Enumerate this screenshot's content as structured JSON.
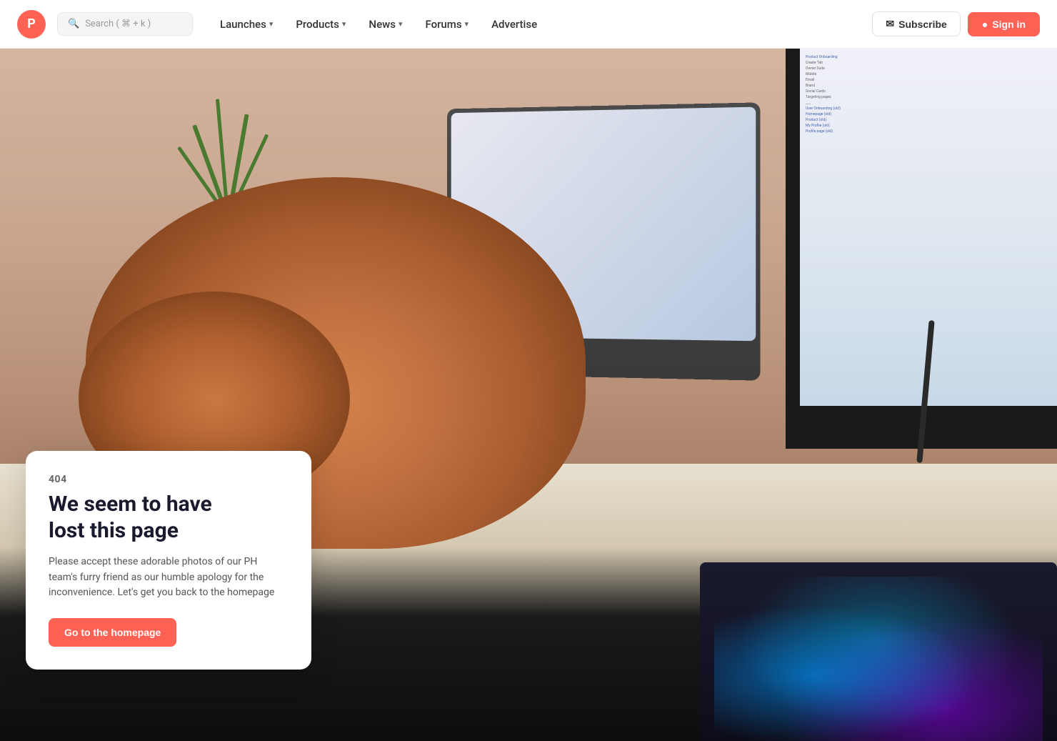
{
  "navbar": {
    "logo_letter": "P",
    "logo_bg": "#ff6154",
    "search_placeholder": "Search ( ⌘ + k )",
    "nav_items": [
      {
        "id": "launches",
        "label": "Launches",
        "has_chevron": true
      },
      {
        "id": "products",
        "label": "Products",
        "has_chevron": true
      },
      {
        "id": "news",
        "label": "News",
        "has_chevron": true
      },
      {
        "id": "forums",
        "label": "Forums",
        "has_chevron": true
      },
      {
        "id": "advertise",
        "label": "Advertise",
        "has_chevron": false
      }
    ],
    "subscribe_label": "Subscribe",
    "signin_label": "Sign in"
  },
  "error_page": {
    "code": "404",
    "title_line1": "We seem to have",
    "title_line2": "lost this page",
    "description": "Please accept these adorable photos of our PH team's furry friend as our humble apology for the inconvenience. Let's get you back to the homepage",
    "cta_label": "Go to the homepage"
  },
  "monitor_content": {
    "items": [
      "Product Onboarding",
      "Create Tab",
      "Owner Suite",
      "Mobile",
      "Email",
      "Brand",
      "Social Cards",
      "Targeting pages",
      "___",
      "User Onboarding (old)",
      "Homepage (old)",
      "Product (old)",
      "My Profile (old)",
      "Profile page (old)"
    ]
  }
}
